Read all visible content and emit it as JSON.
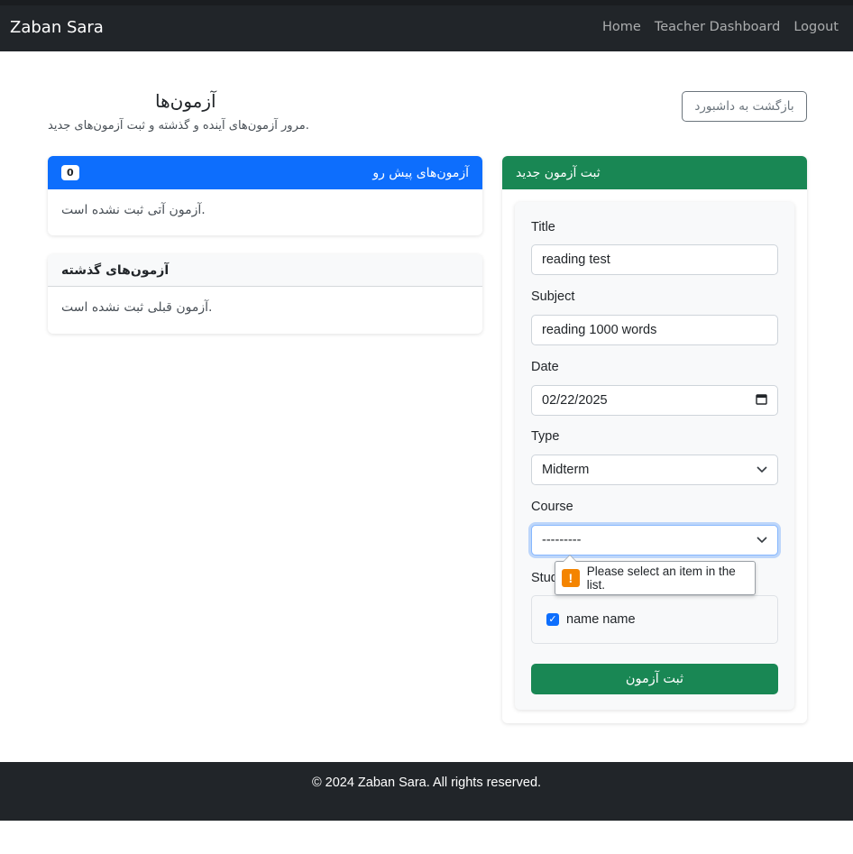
{
  "brand": "Zaban Sara",
  "nav": {
    "home": "Home",
    "dashboard": "Teacher Dashboard",
    "logout": "Logout"
  },
  "header": {
    "title": "آزمون‌ها",
    "subtitle": "مرور آزمون‌های آینده و گذشته و ثبت آزمون‌های جدید.",
    "back_button": "بازگشت به داشبورد"
  },
  "upcoming": {
    "title": "آزمون‌های پیش رو",
    "count": "0",
    "empty": "آزمون آتی ثبت نشده است."
  },
  "past": {
    "title": "آزمون‌های گذشته",
    "empty": "آزمون قبلی ثبت نشده است."
  },
  "form": {
    "title": "ثبت آزمون جدید",
    "title_label": "Title",
    "title_value": "reading test",
    "subject_label": "Subject",
    "subject_value": "reading 1000 words",
    "date_label": "Date",
    "date_value": "02/22/2025",
    "type_label": "Type",
    "type_value": "Midterm",
    "course_label": "Course",
    "course_value": "---------",
    "students_label": "Students",
    "student_name": "name name",
    "submit": "ثبت آزمون"
  },
  "tooltip": {
    "message": "Please select an item in the list."
  },
  "footer": "© 2024 Zaban Sara. All rights reserved.",
  "colors": {
    "primary": "#0d6efd",
    "success": "#198754",
    "dark": "#212529",
    "warning": "#f48400"
  },
  "icons": {
    "calendar": "calendar-icon",
    "chevron": "chevron-down-icon",
    "check": "checkbox-checked-icon",
    "warning": "warning-icon"
  }
}
